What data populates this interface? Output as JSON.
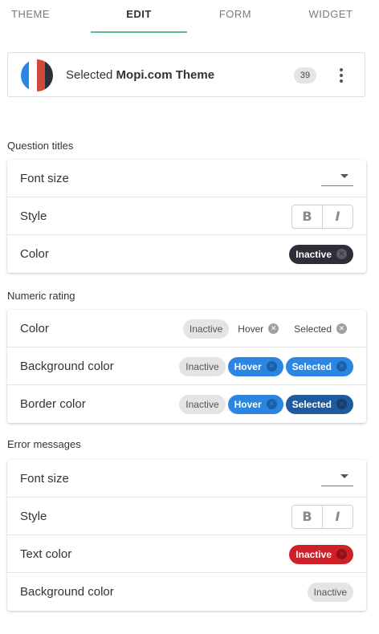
{
  "tabs": [
    {
      "label": "THEME",
      "active": false
    },
    {
      "label": "EDIT",
      "active": true
    },
    {
      "label": "FORM",
      "active": false
    },
    {
      "label": "WIDGET",
      "active": false
    }
  ],
  "theme": {
    "prefix": "Selected",
    "name": "Mopi.com Theme",
    "count": "39",
    "flag_colors": [
      "#2a86e0",
      "#ffffff",
      "#cf4a3a",
      "#2e2e38"
    ]
  },
  "sections": {
    "question_titles": {
      "title": "Question titles",
      "font_size_label": "Font size",
      "style_label": "Style",
      "color_label": "Color",
      "color_chip": "Inactive"
    },
    "numeric_rating": {
      "title": "Numeric rating",
      "color_label": "Color",
      "background_label": "Background color",
      "border_label": "Border color",
      "chip_inactive": "Inactive",
      "chip_hover": "Hover",
      "chip_selected": "Selected"
    },
    "error_messages": {
      "title": "Error messages",
      "font_size_label": "Font size",
      "style_label": "Style",
      "text_color_label": "Text color",
      "text_color_chip": "Inactive",
      "background_label": "Background color",
      "background_chip": "Inactive"
    }
  },
  "style_buttons": {
    "bold": "B",
    "italic": "I"
  },
  "colors": {
    "accent": "#5cc28b",
    "dark_chip": "#2e2e38",
    "blue_chip": "#2a86e0",
    "navy_chip": "#1f5a9e",
    "red_chip": "#cf1f27"
  }
}
